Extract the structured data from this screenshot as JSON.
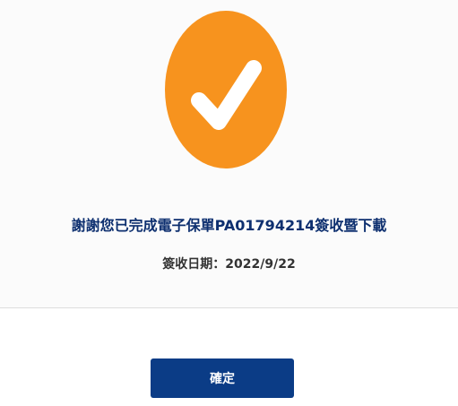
{
  "dialog": {
    "message": "謝謝您已完成電子保單PA01794214簽收暨下載",
    "date_label": "簽收日期：2022/9/22",
    "confirm_label": "確定"
  },
  "icons": {
    "success": "check-circle-icon"
  },
  "colors": {
    "accent": "#f7931e",
    "message_text": "#0d2f6f",
    "primary_button": "#0b3c86"
  }
}
